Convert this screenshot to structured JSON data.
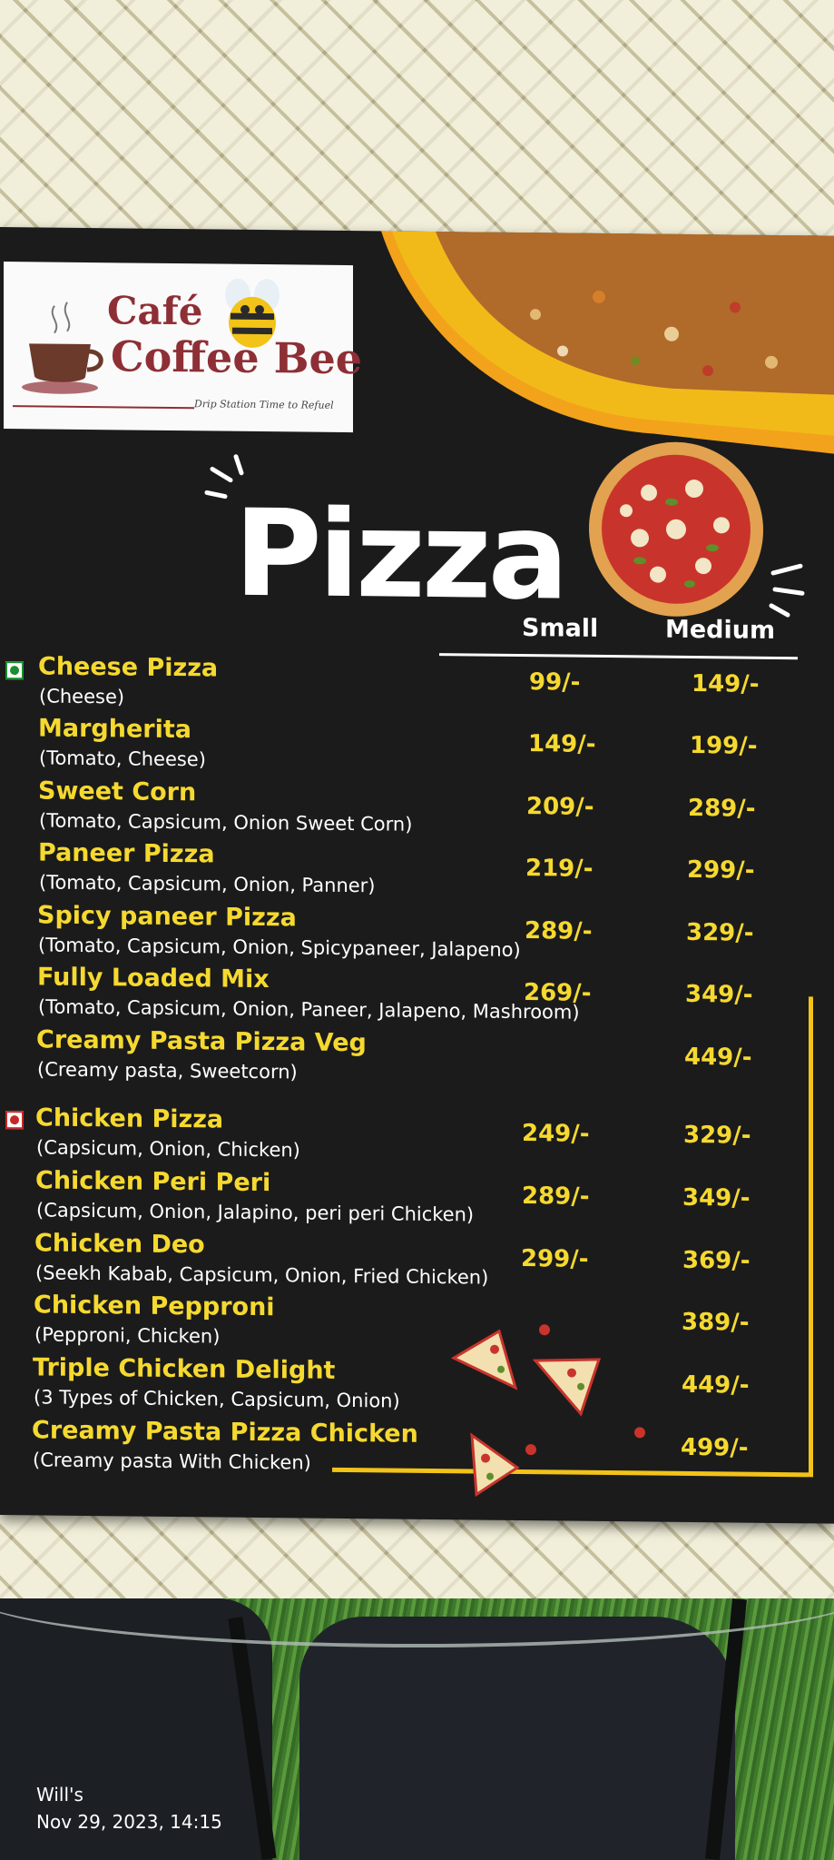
{
  "brand": {
    "line1": "Café",
    "line2": "Coffee Bee",
    "tagline": "Drip Station Time to Refuel"
  },
  "menu": {
    "title": "Pizza",
    "col_small": "Small",
    "col_medium": "Medium",
    "items": [
      {
        "name": "Cheese Pizza",
        "desc": "(Cheese)",
        "small": "99/-",
        "medium": "149/-"
      },
      {
        "name": "Margherita",
        "desc": "(Tomato, Cheese)",
        "small": "149/-",
        "medium": "199/-"
      },
      {
        "name": "Sweet Corn",
        "desc": "(Tomato, Capsicum, Onion Sweet Corn)",
        "small": "209/-",
        "medium": "289/-"
      },
      {
        "name": "Paneer Pizza",
        "desc": "(Tomato, Capsicum, Onion, Panner)",
        "small": "219/-",
        "medium": "299/-"
      },
      {
        "name": "Spicy paneer Pizza",
        "desc": "(Tomato, Capsicum, Onion, Spicypaneer, Jalapeno)",
        "small": "289/-",
        "medium": "329/-"
      },
      {
        "name": "Fully Loaded Mix",
        "desc": "(Tomato, Capsicum, Onion, Paneer, Jalapeno, Mashroom)",
        "small": "269/-",
        "medium": "349/-"
      },
      {
        "name": "Creamy Pasta Pizza Veg",
        "desc": "(Creamy pasta, Sweetcorn)",
        "small": "",
        "medium": "449/-"
      },
      {
        "name": "Chicken Pizza",
        "desc": "(Capsicum, Onion, Chicken)",
        "small": "249/-",
        "medium": "329/-"
      },
      {
        "name": "Chicken Peri Peri",
        "desc": "(Capsicum, Onion, Jalapino, peri peri Chicken)",
        "small": "289/-",
        "medium": "349/-"
      },
      {
        "name": "Chicken Deo",
        "desc": "(Seekh Kabab, Capsicum, Onion, Fried Chicken)",
        "small": "299/-",
        "medium": "369/-"
      },
      {
        "name": "Chicken Pepproni",
        "desc": "(Pepproni, Chicken)",
        "small": "",
        "medium": "389/-"
      },
      {
        "name": "Triple Chicken Delight",
        "desc": "(3 Types of Chicken, Capsicum, Onion)",
        "small": "",
        "medium": "449/-"
      },
      {
        "name": "Creamy Pasta Pizza Chicken",
        "desc": "(Creamy pasta With Chicken)",
        "small": "",
        "medium": "499/-"
      }
    ]
  },
  "photo_stamp": {
    "author": "Will's",
    "datetime": "Nov 29, 2023, 14:15"
  },
  "colors": {
    "accent_yellow": "#f6d92f",
    "card_bg": "#1b1b1c",
    "brand_maroon": "#8e2f35"
  }
}
